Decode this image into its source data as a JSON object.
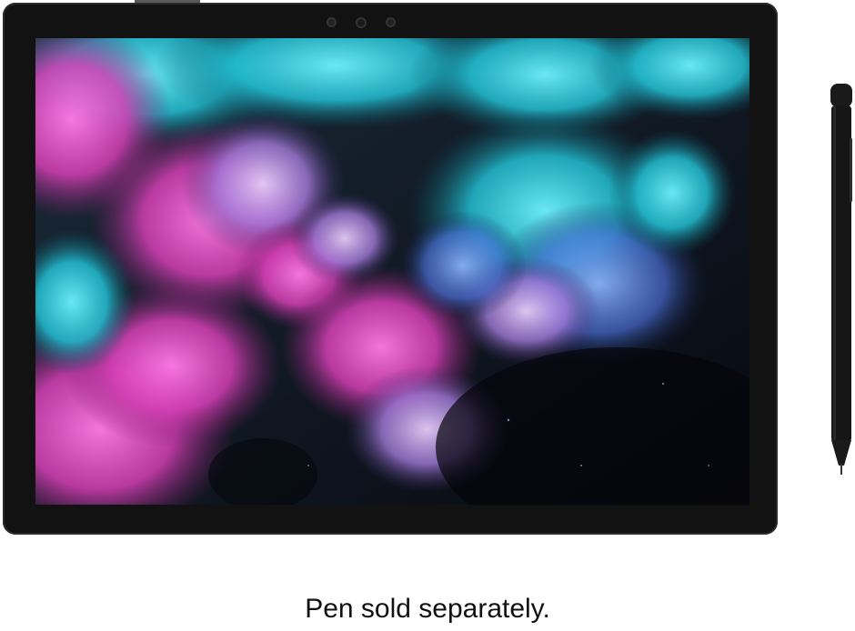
{
  "caption": {
    "text": "Pen sold separately."
  },
  "colors": {
    "background": "#ffffff",
    "tablet_frame": "#121212",
    "screen_dark": "#0a0b14",
    "pink": "#e04fc2",
    "cyan": "#2dcfe0",
    "lavender": "#b48be3",
    "pen": "#111111",
    "caption_text": "#111111"
  }
}
